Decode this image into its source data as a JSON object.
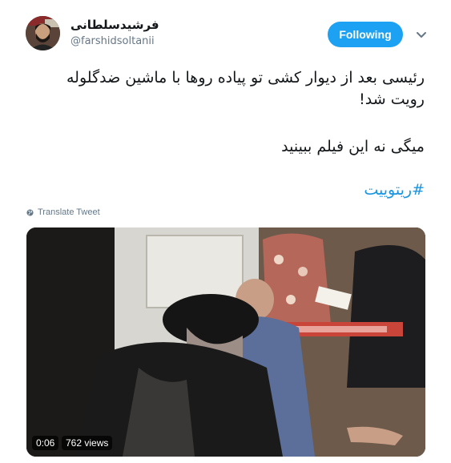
{
  "author": {
    "display_name": "فرشیدسلطانی",
    "handle": "@farshidsoltanii"
  },
  "follow_button": {
    "label": "Following"
  },
  "tweet": {
    "line_1": "رئیسی بعد از دیوار کشی تو پیاده روها با ماشین ضدگلوله",
    "line_2": "رویت شد!",
    "line_3": "میگی نه این فیلم ببینید",
    "hashtag": "#ریتوییت"
  },
  "translate_link": "Translate Tweet",
  "video": {
    "time": "0:06",
    "views": "762 views"
  },
  "icons": {
    "more": "chevron-down-icon",
    "translate": "globe-icon"
  },
  "colors": {
    "accent": "#1da1f2",
    "link": "#1b95e0",
    "secondary_text": "#657786"
  }
}
